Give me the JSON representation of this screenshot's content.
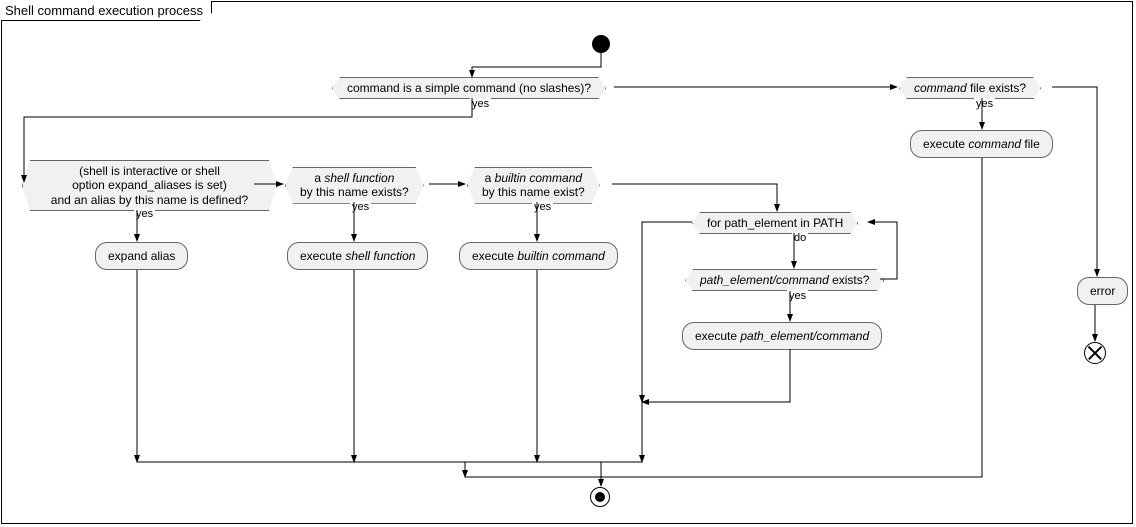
{
  "frame": {
    "title": "Shell command execution process"
  },
  "decisions": {
    "d1": "command is a simple command (no slashes)?",
    "d2_line1": "(shell is interactive or shell",
    "d2_line2": "option expand_aliases is set)",
    "d2_line3": "and an alias by this name is defined?",
    "d3_pre": "a ",
    "d3_em": "shell function",
    "d3_post": "",
    "d3_line2": "by this name exists?",
    "d4_pre": "a ",
    "d4_em": "builtin command",
    "d4_line2": "by this name exist?",
    "d5": "for path_element in PATH",
    "d6_em": "path_element/command",
    "d6_post": " exists?",
    "d7_em": "command",
    "d7_post": " file exists?"
  },
  "actions": {
    "a1": "expand alias",
    "a2_pre": "execute ",
    "a2_em": "shell function",
    "a3_pre": "execute ",
    "a3_em": "builtin command",
    "a4_pre": "execute ",
    "a4_em": "path_element/command",
    "a5_pre": "execute ",
    "a5_em": "command",
    "a5_post": " file",
    "a6": "error"
  },
  "labels": {
    "yes": "yes",
    "do": "do"
  },
  "chart_data": {
    "type": "activity-diagram",
    "title": "Shell command execution process",
    "start": "start",
    "nodes": [
      {
        "id": "d1",
        "type": "decision",
        "text": "command is a simple command (no slashes)?"
      },
      {
        "id": "d2",
        "type": "decision",
        "text": "(shell is interactive or shell option expand_aliases is set) and an alias by this name is defined?"
      },
      {
        "id": "a1",
        "type": "action",
        "text": "expand alias"
      },
      {
        "id": "d3",
        "type": "decision",
        "text": "a shell function by this name exists?"
      },
      {
        "id": "a2",
        "type": "action",
        "text": "execute shell function"
      },
      {
        "id": "d4",
        "type": "decision",
        "text": "a builtin command by this name exist?"
      },
      {
        "id": "a3",
        "type": "action",
        "text": "execute builtin command"
      },
      {
        "id": "d5",
        "type": "loop",
        "text": "for path_element in PATH"
      },
      {
        "id": "d6",
        "type": "decision",
        "text": "path_element/command exists?"
      },
      {
        "id": "a4",
        "type": "action",
        "text": "execute path_element/command"
      },
      {
        "id": "d7",
        "type": "decision",
        "text": "command file exists?"
      },
      {
        "id": "a5",
        "type": "action",
        "text": "execute command file"
      },
      {
        "id": "a6",
        "type": "action",
        "text": "error"
      },
      {
        "id": "end",
        "type": "final"
      },
      {
        "id": "error-end",
        "type": "flow-final"
      }
    ],
    "edges": [
      {
        "from": "start",
        "to": "d1"
      },
      {
        "from": "d1",
        "to": "d2",
        "label": "yes"
      },
      {
        "from": "d1",
        "to": "d7",
        "label": ""
      },
      {
        "from": "d2",
        "to": "a1",
        "label": "yes"
      },
      {
        "from": "d2",
        "to": "d3",
        "label": ""
      },
      {
        "from": "a1",
        "to": "end"
      },
      {
        "from": "d3",
        "to": "a2",
        "label": "yes"
      },
      {
        "from": "d3",
        "to": "d4",
        "label": ""
      },
      {
        "from": "a2",
        "to": "end"
      },
      {
        "from": "d4",
        "to": "a3",
        "label": "yes"
      },
      {
        "from": "d4",
        "to": "d5",
        "label": ""
      },
      {
        "from": "a3",
        "to": "end"
      },
      {
        "from": "d5",
        "to": "d6",
        "label": "do"
      },
      {
        "from": "d6",
        "to": "a4",
        "label": "yes"
      },
      {
        "from": "d6",
        "to": "d5",
        "label": ""
      },
      {
        "from": "a4",
        "to": "end"
      },
      {
        "from": "d5",
        "to": "end",
        "label": ""
      },
      {
        "from": "d7",
        "to": "a5",
        "label": "yes"
      },
      {
        "from": "d7",
        "to": "a6",
        "label": ""
      },
      {
        "from": "a5",
        "to": "end"
      },
      {
        "from": "a6",
        "to": "error-end"
      }
    ]
  }
}
